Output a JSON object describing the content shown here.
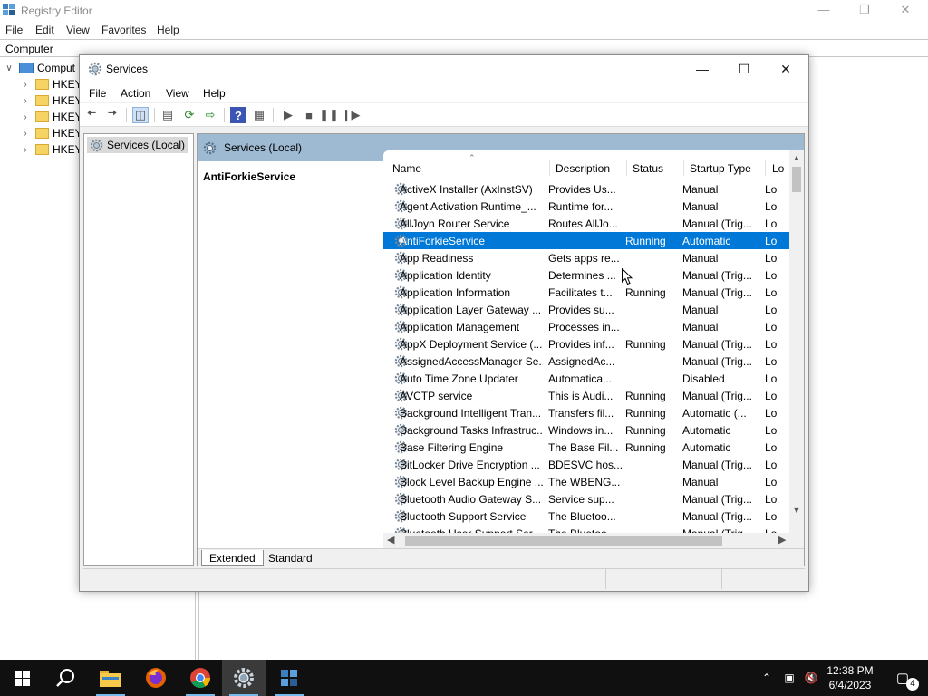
{
  "registry": {
    "title": "Registry Editor",
    "menu": [
      "File",
      "Edit",
      "View",
      "Favorites",
      "Help"
    ],
    "address": "Computer",
    "tree": {
      "root_label": "Comput",
      "children": [
        "HKEY",
        "HKEY",
        "HKEY",
        "HKEY",
        "HKEY"
      ]
    }
  },
  "services": {
    "title": "Services",
    "menu": [
      "File",
      "Action",
      "View",
      "Help"
    ],
    "scope_node": "Services (Local)",
    "header_tab": "Services (Local)",
    "selected_name": "AntiForkieService",
    "columns": [
      "Name",
      "Description",
      "Status",
      "Startup Type",
      "Lo"
    ],
    "rows": [
      [
        "ActiveX Installer (AxInstSV)",
        "Provides Us...",
        "",
        "Manual",
        "Lo"
      ],
      [
        "Agent Activation Runtime_...",
        "Runtime for...",
        "",
        "Manual",
        "Lo"
      ],
      [
        "AllJoyn Router Service",
        "Routes AllJo...",
        "",
        "Manual (Trig...",
        "Lo"
      ],
      [
        "AntiForkieService",
        "",
        "Running",
        "Automatic",
        "Lo"
      ],
      [
        "App Readiness",
        "Gets apps re...",
        "",
        "Manual",
        "Lo"
      ],
      [
        "Application Identity",
        "Determines ...",
        "",
        "Manual (Trig...",
        "Lo"
      ],
      [
        "Application Information",
        "Facilitates t...",
        "Running",
        "Manual (Trig...",
        "Lo"
      ],
      [
        "Application Layer Gateway ...",
        "Provides su...",
        "",
        "Manual",
        "Lo"
      ],
      [
        "Application Management",
        "Processes in...",
        "",
        "Manual",
        "Lo"
      ],
      [
        "AppX Deployment Service (...",
        "Provides inf...",
        "Running",
        "Manual (Trig...",
        "Lo"
      ],
      [
        "AssignedAccessManager Se...",
        "AssignedAc...",
        "",
        "Manual (Trig...",
        "Lo"
      ],
      [
        "Auto Time Zone Updater",
        "Automatica...",
        "",
        "Disabled",
        "Lo"
      ],
      [
        "AVCTP service",
        "This is Audi...",
        "Running",
        "Manual (Trig...",
        "Lo"
      ],
      [
        "Background Intelligent Tran...",
        "Transfers fil...",
        "Running",
        "Automatic (...",
        "Lo"
      ],
      [
        "Background Tasks Infrastruc...",
        "Windows in...",
        "Running",
        "Automatic",
        "Lo"
      ],
      [
        "Base Filtering Engine",
        "The Base Fil...",
        "Running",
        "Automatic",
        "Lo"
      ],
      [
        "BitLocker Drive Encryption ...",
        "BDESVC hos...",
        "",
        "Manual (Trig...",
        "Lo"
      ],
      [
        "Block Level Backup Engine ...",
        "The WBENG...",
        "",
        "Manual",
        "Lo"
      ],
      [
        "Bluetooth Audio Gateway S...",
        "Service sup...",
        "",
        "Manual (Trig...",
        "Lo"
      ],
      [
        "Bluetooth Support Service",
        "The Bluetoo...",
        "",
        "Manual (Trig...",
        "Lo"
      ],
      [
        "Bluetooth User Support Ser...",
        "The Bluetoo...",
        "",
        "Manual (Trig...",
        "Lo"
      ]
    ],
    "selected_row": 3,
    "tabs": [
      "Extended",
      "Standard"
    ],
    "active_tab": "Extended"
  },
  "taskbar": {
    "time": "12:38 PM",
    "date": "6/4/2023",
    "notification_count": "4"
  },
  "colors": {
    "selection": "#0078d7",
    "header_band": "#9ebad3",
    "taskbar": "#101010"
  }
}
